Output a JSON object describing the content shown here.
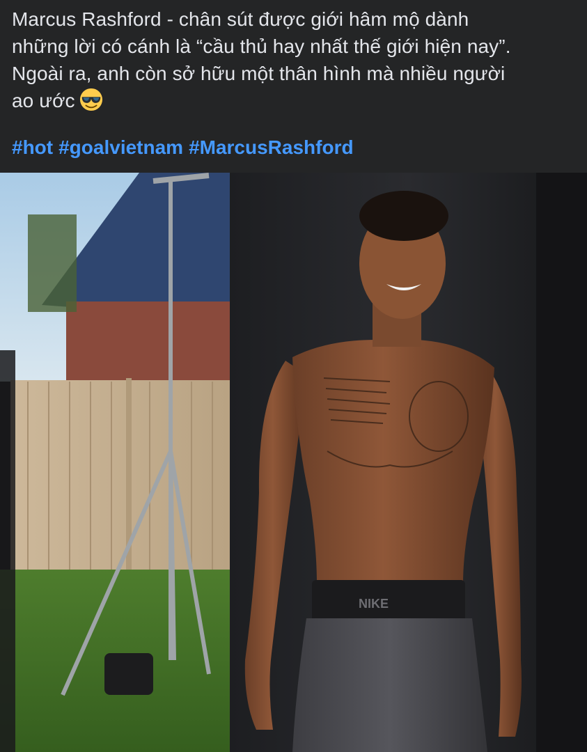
{
  "post": {
    "caption_lines": [
      "Marcus Rashford - chân sút được giới hâm mộ dành",
      "những lời có cánh là “cầu thủ hay nhất thế giới hiện nay”.",
      "Ngoài ra, anh còn sở hữu một thân hình mà nhiều người",
      "ao ước"
    ],
    "emoji": "sunglasses-face-emoji",
    "hashtags": [
      "#hot",
      "#goalvietnam",
      "#MarcusRashford"
    ],
    "photo_text": {
      "waistband_brand": "NIKE"
    }
  },
  "colors": {
    "background": "#242526",
    "text": "#e4e6eb",
    "hashtag": "#4599ff"
  }
}
